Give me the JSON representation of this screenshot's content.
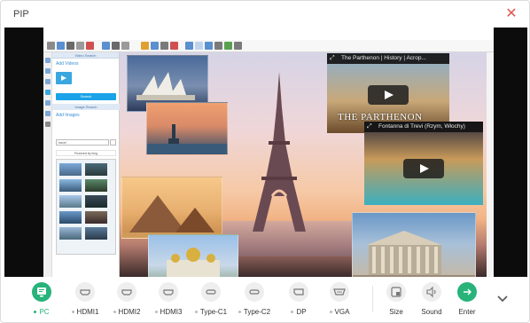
{
  "window": {
    "title": "PIP",
    "close_icon": "close-icon",
    "accent_color": "#27b37a",
    "close_color": "#e0584f"
  },
  "preview": {
    "app": {
      "panel": {
        "header1": "Video Search",
        "videos_title": "Add Videos",
        "search_button": "Search",
        "header2": "Image Search",
        "images_title": "Add Images",
        "search_value": "travel",
        "powered_by": "Powered by bing"
      }
    },
    "videos": [
      {
        "title": "The Parthenon | History | Acrop...",
        "overlay_text": "THE PARTHENON"
      },
      {
        "title": "Fontanna di Trevi (Rzym, Włochy)"
      }
    ]
  },
  "sources": [
    {
      "label": "PC",
      "icon": "pc-icon",
      "active": true
    },
    {
      "label": "HDMI1",
      "icon": "hdmi-icon",
      "active": false
    },
    {
      "label": "HDMI2",
      "icon": "hdmi-icon",
      "active": false
    },
    {
      "label": "HDMI3",
      "icon": "hdmi-icon",
      "active": false
    },
    {
      "label": "Type-C1",
      "icon": "usb-c-icon",
      "active": false
    },
    {
      "label": "Type-C2",
      "icon": "usb-c-icon",
      "active": false
    },
    {
      "label": "DP",
      "icon": "displayport-icon",
      "active": false
    },
    {
      "label": "VGA",
      "icon": "vga-icon",
      "active": false
    }
  ],
  "actions": [
    {
      "label": "Size",
      "icon": "size-icon"
    },
    {
      "label": "Sound",
      "icon": "speaker-icon"
    },
    {
      "label": "Enter",
      "icon": "arrow-right-icon"
    }
  ],
  "more_icon": "chevron-down-icon"
}
